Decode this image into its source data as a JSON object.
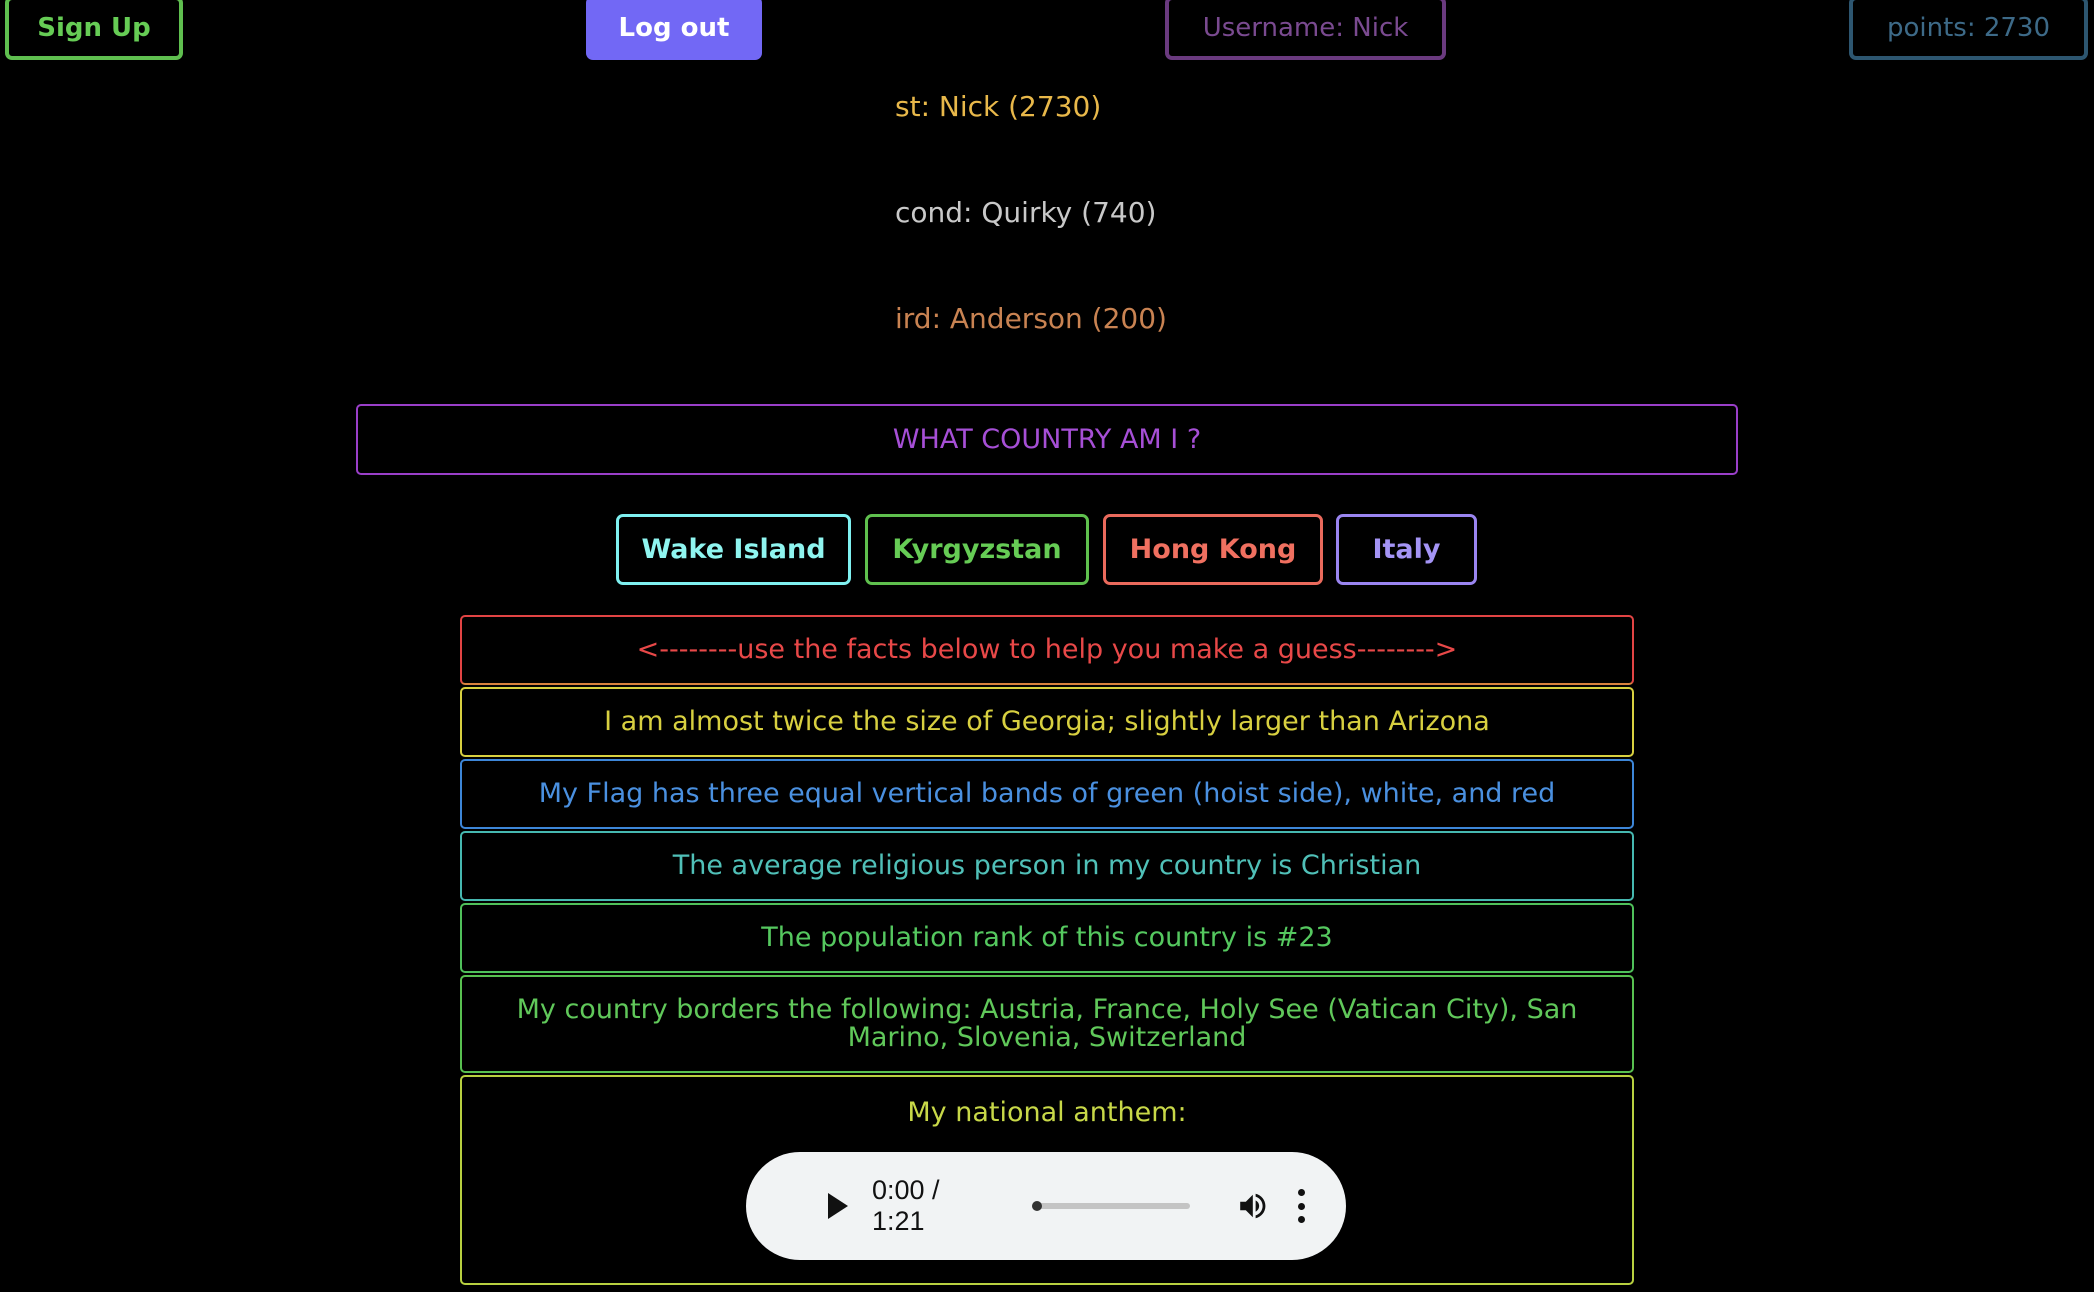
{
  "nav": {
    "signup_label": "Sign Up",
    "logout_label": "Log out",
    "username_label": "Username: Nick",
    "points_label": "points: 2730"
  },
  "leaderboard": [
    {
      "text": "st: Nick (2730)"
    },
    {
      "text": "cond: Quirky (740)"
    },
    {
      "text": "ird: Anderson (200)"
    }
  ],
  "question": "WHAT COUNTRY AM I ?",
  "options": [
    "Wake Island",
    "Kyrgyzstan",
    "Hong Kong",
    "Italy"
  ],
  "facts": [
    "<--------use the facts below to help you make a guess-------->",
    "I am almost twice the size of Georgia; slightly larger than Arizona",
    "My Flag has three equal vertical bands of green (hoist side), white, and red",
    "The average religious person in my country is Christian",
    "The population rank of this country is #23",
    "My country borders the following: Austria, France, Holy See (Vatican City), San Marino, Slovenia, Switzerland",
    "My national anthem:"
  ],
  "audio": {
    "time": "0:00 / 1:21",
    "progress": 0,
    "icons": [
      "play-icon",
      "volume-icon",
      "more-vert-icon"
    ]
  }
}
